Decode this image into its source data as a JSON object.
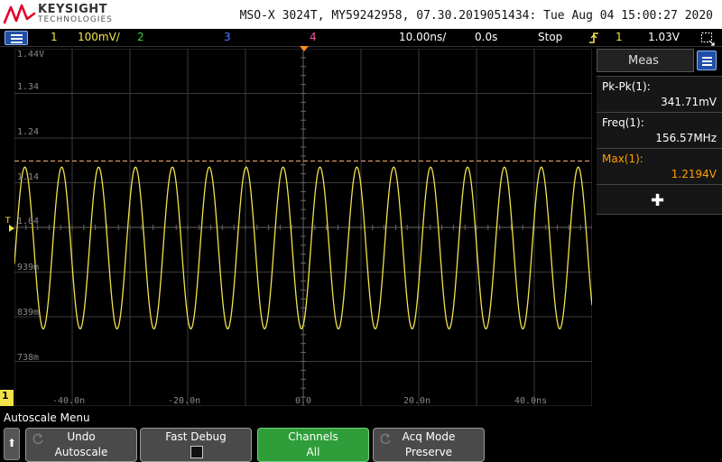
{
  "header": {
    "brand": "KEYSIGHT",
    "brand_sub": "TECHNOLOGIES",
    "model_line": "MSO-X 3024T, MY59242958, 07.30.2019051434: Tue Aug 04 15:00:27 2020"
  },
  "status": {
    "ch1": "1",
    "ch1_scale": "100mV/",
    "ch2": "2",
    "ch3": "3",
    "ch4": "4",
    "timebase": "10.00ns/",
    "delay": "0.0s",
    "run_state": "Stop",
    "trig_source": "1",
    "trig_level": "1.03V"
  },
  "graticule": {
    "y_labels": [
      "1.44V",
      "1.34",
      "1.24",
      "1.14",
      "1.04",
      "939m",
      "839m",
      "738m"
    ],
    "x_labels": [
      "-40.0n",
      "-20.0n",
      "0.0",
      "20.0n",
      "40.0ns"
    ],
    "trigger_label": "T",
    "ch1_marker": "1"
  },
  "meas": {
    "title": "Meas",
    "items": [
      {
        "label": "Pk-Pk(1):",
        "value": "341.71mV",
        "color": "#ffffff"
      },
      {
        "label": "Freq(1):",
        "value": "156.57MHz",
        "color": "#ffffff"
      },
      {
        "label": "Max(1):",
        "value": "1.2194V",
        "color": "#ffa000"
      }
    ],
    "add_icon": "plus-icon"
  },
  "softkeys": {
    "title": "Autoscale Menu",
    "keys": [
      {
        "l1": "Undo",
        "l2": "Autoscale"
      },
      {
        "l1": "Fast Debug",
        "l2": ""
      },
      {
        "l1": "Channels",
        "l2": "All"
      },
      {
        "l1": "Acq Mode",
        "l2": "Preserve"
      }
    ]
  },
  "colors": {
    "ch1": "#f2e34a",
    "ch2": "#3fd13f",
    "ch3": "#4f7fff",
    "ch4": "#ff4fa3",
    "max_line": "#e8a070",
    "accent_blue": "#1f4fa8",
    "softkey_green": "#2f9e3a"
  },
  "waveform": {
    "frequency_mhz": 156.57,
    "max_v": 1.2194,
    "pk_pk_mv": 341.71,
    "time_range_ns": [
      -50,
      50
    ],
    "volt_range": [
      0.738,
      1.44
    ]
  }
}
